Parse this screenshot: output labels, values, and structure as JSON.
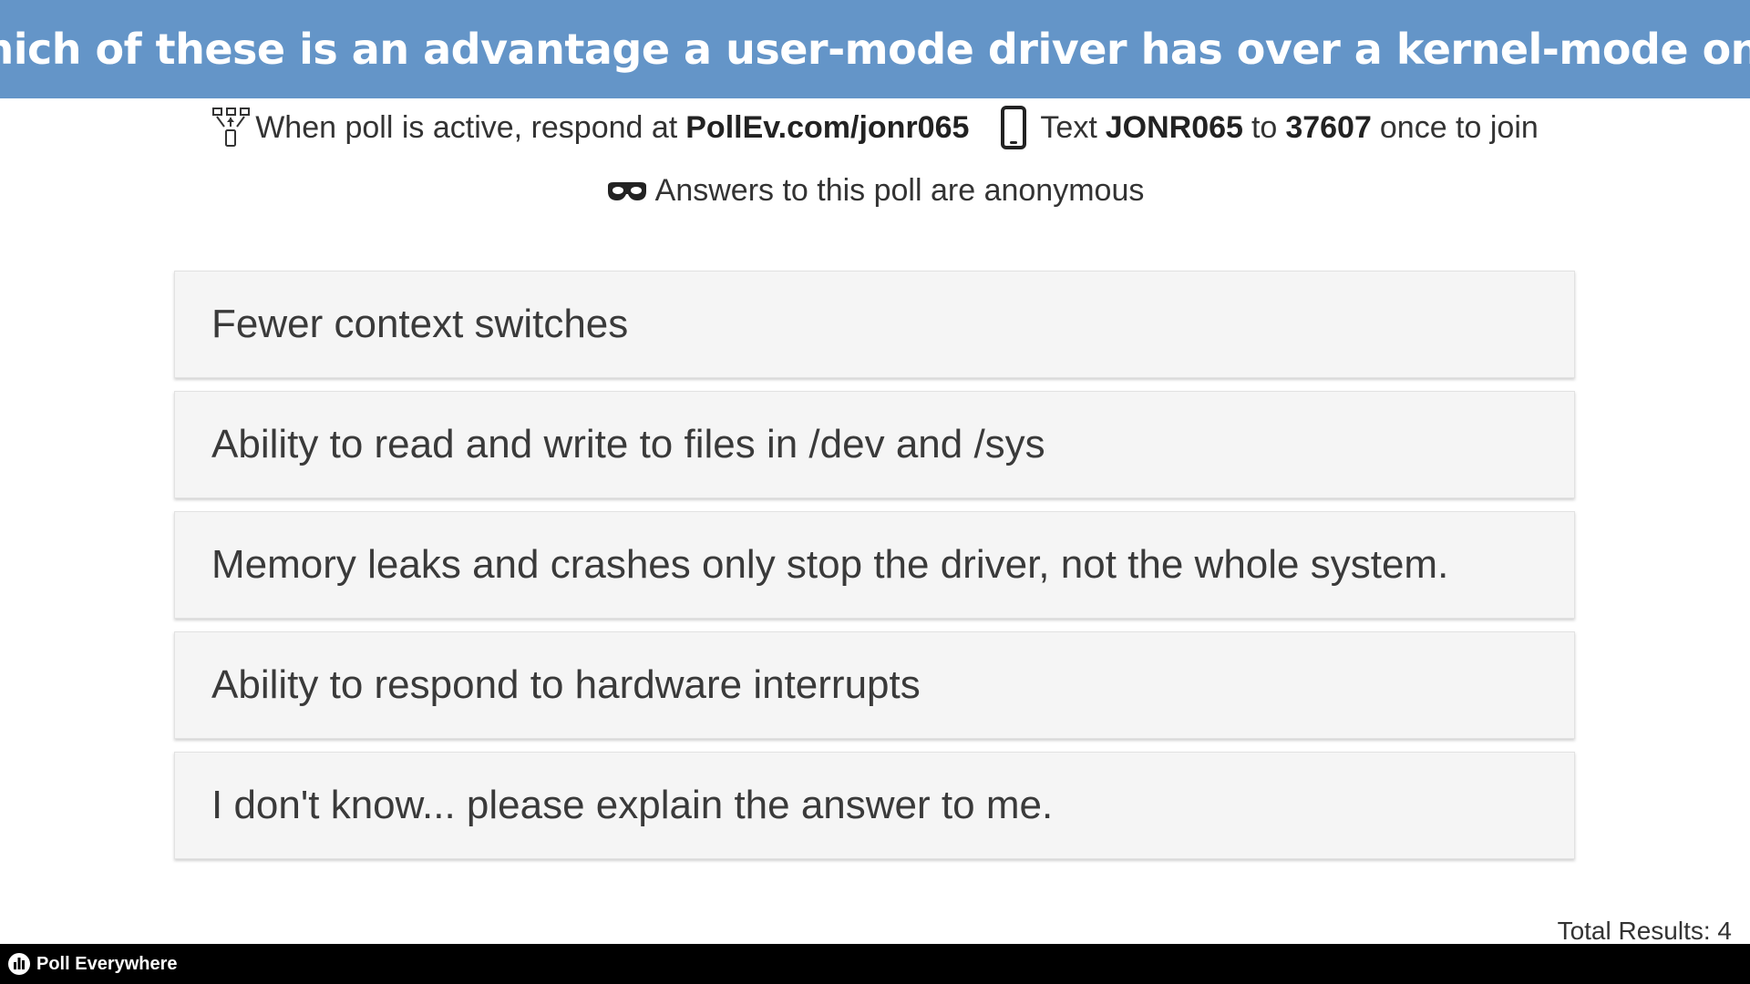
{
  "question": {
    "title": "Which of these is an advantage a user-mode driver has over a kernel-mode one?"
  },
  "instructions": {
    "web_prefix": "When poll is active, respond at",
    "web_url": "PollEv.com/jonr065",
    "text_prefix": "Text",
    "text_code": "JONR065",
    "text_to": "to",
    "text_number": "37607",
    "text_suffix": "once to join",
    "anonymous": "Answers to this poll are anonymous"
  },
  "options": [
    {
      "label": "Fewer context switches"
    },
    {
      "label": "Ability to read and write to files in /dev and /sys"
    },
    {
      "label": "Memory leaks and crashes only stop the driver, not the whole system."
    },
    {
      "label": "Ability to respond to hardware interrupts"
    },
    {
      "label": "I don't know... please explain the answer to me."
    }
  ],
  "results": {
    "total": "Total Results: 4"
  },
  "footer": {
    "brand": "Poll Everywhere"
  },
  "colors": {
    "header_bg": "#6495c8",
    "option_bg": "#f5f5f5",
    "footer_bg": "#000000"
  }
}
